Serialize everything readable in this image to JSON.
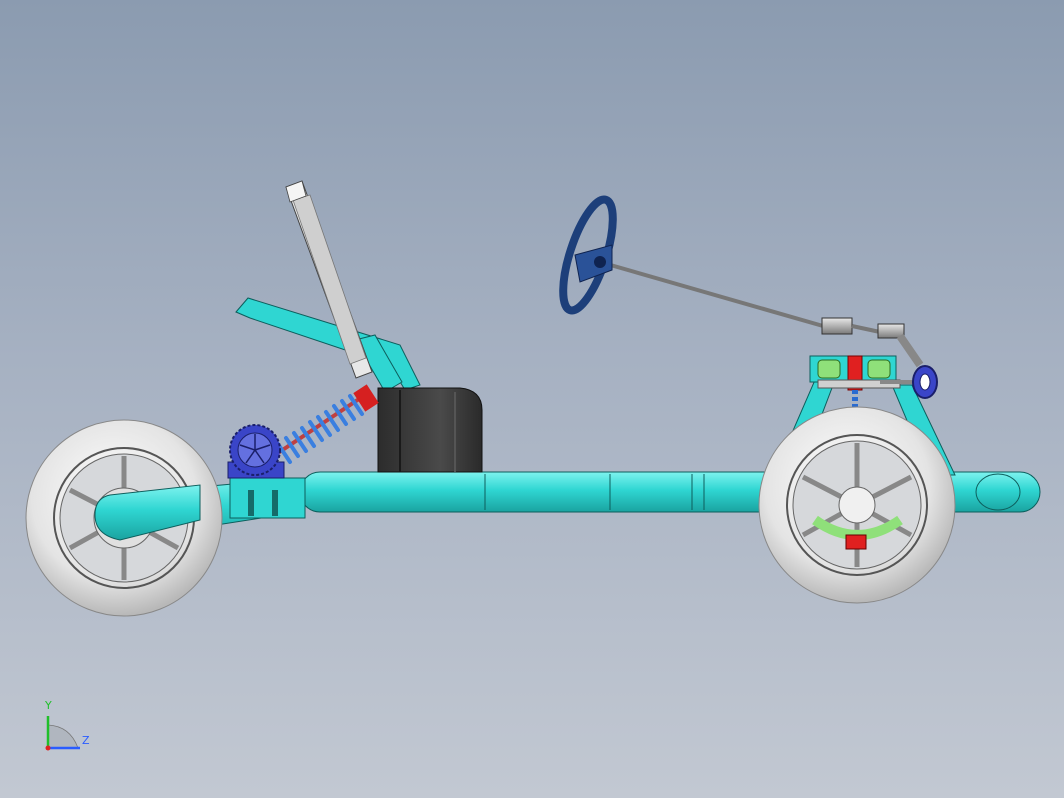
{
  "triad": {
    "y_label": "Y",
    "z_label": "Z",
    "y_color": "#1fbf2a",
    "z_color": "#2a5cff",
    "x_color": "#e02020"
  },
  "colors": {
    "frame": "#2fd6d2",
    "tire": "#e6e6e6",
    "rim": "#b9bcc0",
    "seat": "#3a3a3a",
    "spring": "#3a7fe0",
    "steering_wheel": "#1d3f7a",
    "motor": "#3a45c8",
    "suspension_arm": "#8fe07a",
    "accent_red": "#e02020"
  }
}
